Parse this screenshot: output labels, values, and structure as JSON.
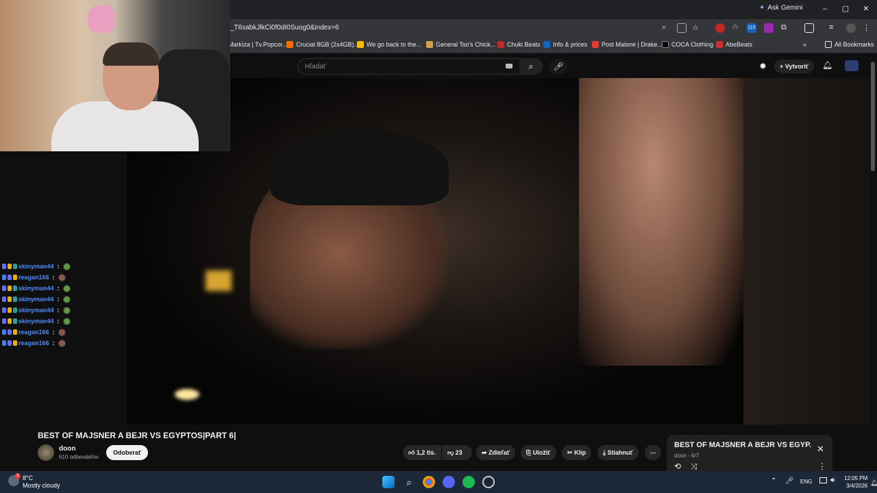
{
  "browser": {
    "gemini_label": "Ask Gemini",
    "url": "_T6sabkJlkCi0f0dI0Suog0&index=6",
    "window_buttons": [
      "–",
      "▢",
      "✕"
    ],
    "bookmarks": [
      {
        "label": "Markíza | Tv.Popcor...",
        "color": "#1e88e5"
      },
      {
        "label": "Crucial 8GB (2x4GB)...",
        "color": "#ff6d00"
      },
      {
        "label": "We go back to the...",
        "color": "#fbbc05"
      },
      {
        "label": "General Tso's Chick...",
        "color": "#d4a050"
      },
      {
        "label": "Chuki Beats",
        "color": "#c62828"
      },
      {
        "label": "Info & prices",
        "color": "#1565c0"
      },
      {
        "label": "Post Malone | Drake...",
        "color": "#e53935"
      },
      {
        "label": "COCA Clothing",
        "color": "#000000"
      },
      {
        "label": "AbeBeats",
        "color": "#d32f2f"
      }
    ],
    "all_bookmarks": "All Bookmarks",
    "badge_count": "110"
  },
  "youtube": {
    "search_placeholder": "Hľadať",
    "create_label": "Vytvoriť",
    "video_title": "BEST OF MAJSNER A BEJR VS EGYPTOS|PART 6|",
    "channel": "doon",
    "subscribers": "610 odberateľov",
    "subscribe": "Odoberať",
    "likes": "1,2 tis.",
    "dislikes": "23",
    "share": "Zdieľať",
    "save": "Uložiť",
    "clip": "Klip",
    "download": "Stiahnuť",
    "playlist_title": "BEST OF MAJSNER A BEJR VS EGYP...",
    "playlist_sub": "doon - 6/7"
  },
  "chat": [
    {
      "user": "skinyman44",
      "color": "#4a8cff"
    },
    {
      "user": "reagan166",
      "color": "#4a8cff"
    },
    {
      "user": "skinyman44",
      "color": "#4a8cff"
    },
    {
      "user": "skinyman44",
      "color": "#4a8cff"
    },
    {
      "user": "skinyman44",
      "color": "#4a8cff"
    },
    {
      "user": "skinyman44",
      "color": "#4a8cff"
    },
    {
      "user": "reagan166",
      "color": "#4a8cff"
    },
    {
      "user": "reagan166",
      "color": "#4a8cff"
    }
  ],
  "taskbar": {
    "temp": "8°C",
    "weather": "Mostly cloudy",
    "lang": "ENG",
    "time": "12:05 PM",
    "date": "3/4/2026",
    "weather_badge": "3"
  }
}
